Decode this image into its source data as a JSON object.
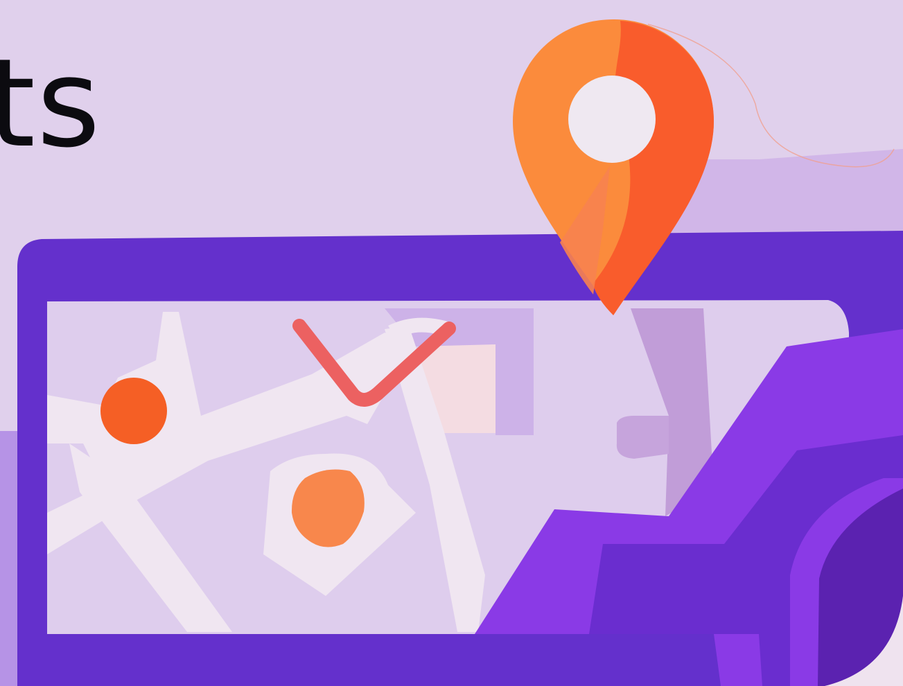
{
  "banner": {
    "heading_fragment": "ts"
  },
  "illustration": {
    "subject": "map-with-location-pin",
    "colors": {
      "background": "#e0d0ec",
      "frame": "#6430cc",
      "map": "#decded",
      "roads": "#f0e6f1",
      "pin_light": "#fb8b3c",
      "pin_dark": "#f95c2c",
      "marker_red": "#f55f25",
      "marker_orange": "#f8874c",
      "route": "#ec6161",
      "vehicle_bright": "#8a3ae6",
      "vehicle_dark": "#5b22b0"
    },
    "icons": [
      "location-pin-icon",
      "map-marker-icon",
      "check-mark-icon"
    ]
  }
}
